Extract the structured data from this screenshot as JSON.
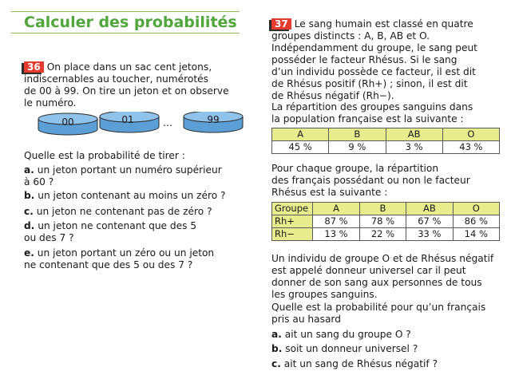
{
  "title": "Calculer des probabilités",
  "ex36": {
    "number": "36",
    "intro": [
      "On place dans un sac cent jetons,",
      "indiscernables au toucher, numérotés",
      "de 00 à 99. On tire un jeton et on observe",
      "le numéro."
    ],
    "tokens": [
      "00",
      "01",
      "…",
      "99"
    ],
    "question": "Quelle est la probabilité de tirer :",
    "items": [
      {
        "letter": "a.",
        "lines": [
          "un jeton portant un numéro supérieur",
          "à 60 ?"
        ]
      },
      {
        "letter": "b.",
        "lines": [
          "un jeton contenant au moins un zéro ?"
        ]
      },
      {
        "letter": "c.",
        "lines": [
          "un jeton ne contenant pas de zéro ?"
        ]
      },
      {
        "letter": "d.",
        "lines": [
          "un jeton ne contenant que des 5",
          "ou des 7 ?"
        ]
      },
      {
        "letter": "e.",
        "lines": [
          "un jeton portant un zéro ou un jeton",
          "ne contenant que des 5 ou des 7 ?"
        ]
      }
    ]
  },
  "ex37": {
    "number": "37",
    "intro": [
      "Le sang humain est classé en quatre",
      "groupes distincts : A, B, AB et O.",
      "Indépendamment du groupe, le sang peut",
      "posséder le facteur Rhésus. Si le sang",
      "d’un individu possède ce facteur, il est dit",
      "de Rhésus positif (Rh+) ; sinon, il est dit",
      "de Rhésus négatif (Rh−).",
      "La répartition des groupes sanguins dans",
      "la population française est la suivante :"
    ],
    "table1": {
      "headers": [
        "A",
        "B",
        "AB",
        "O"
      ],
      "values": [
        "45 %",
        "9 %",
        "3 %",
        "43 %"
      ]
    },
    "middle": [
      "Pour chaque groupe, la répartition",
      "des français possédant ou non le facteur",
      "Rhésus est la suivante :"
    ],
    "table2": {
      "headers": [
        "Groupe",
        "A",
        "B",
        "AB",
        "O"
      ],
      "rows": [
        [
          "Rh+",
          "87 %",
          "78 %",
          "67 %",
          "86 %"
        ],
        [
          "Rh−",
          "13 %",
          "22 %",
          "33 %",
          "14 %"
        ]
      ]
    },
    "outro": [
      "Un individu de groupe O et de Rhésus négatif",
      "est appelé donneur universel car il peut",
      "donner de son sang aux personnes de tous",
      "les groupes sanguins."
    ],
    "question": [
      "Quelle est la probabilité pour qu’un français",
      "pris au hasard"
    ],
    "items": [
      {
        "letter": "a.",
        "text": "ait un sang du groupe O ?"
      },
      {
        "letter": "b.",
        "text": "soit un donneur universel ?"
      },
      {
        "letter": "c.",
        "text": "ait un sang de Rhésus négatif ?"
      }
    ]
  },
  "colors": {
    "title_green": "#4fa63a",
    "rule_green": "#8cc152",
    "badge_red": "#e53a2f",
    "token_blue": "#7fb8e6",
    "table_header_yellow": "#e7ec8d"
  }
}
